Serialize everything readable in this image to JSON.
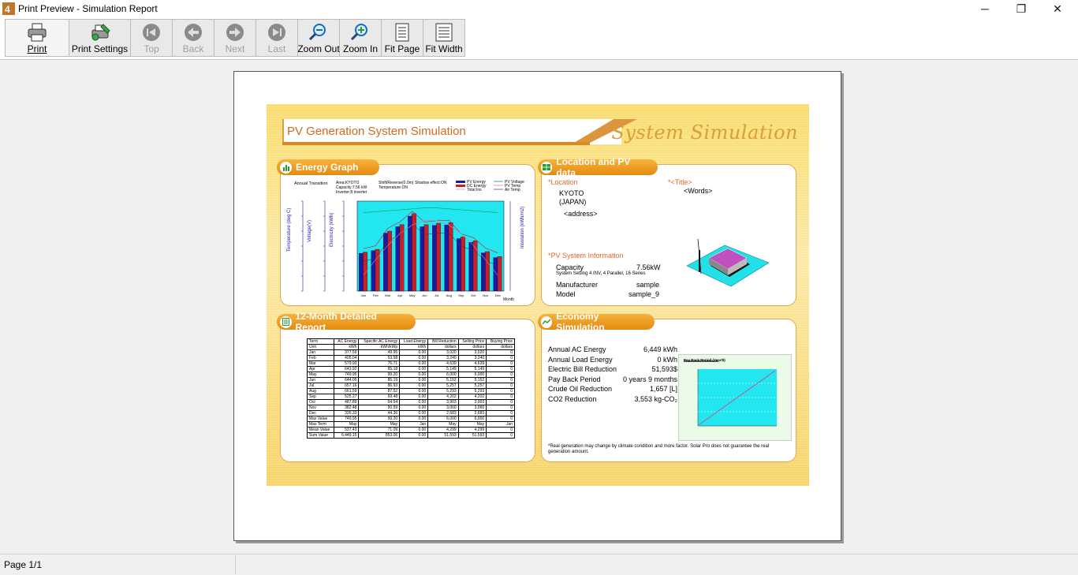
{
  "window": {
    "title": "Print Preview - Simulation Report",
    "controls": [
      "─",
      "❐",
      "✕"
    ]
  },
  "toolbar": {
    "buttons": [
      {
        "label": "Print",
        "icon": "printer-icon",
        "enabled": true
      },
      {
        "label": "Print Settings",
        "icon": "print-settings-icon",
        "enabled": true
      },
      {
        "label": "Top",
        "icon": "first-page-icon",
        "enabled": false
      },
      {
        "label": "Back",
        "icon": "previous-page-icon",
        "enabled": false
      },
      {
        "label": "Next",
        "icon": "next-page-icon",
        "enabled": false
      },
      {
        "label": "Last",
        "icon": "last-page-icon",
        "enabled": false
      },
      {
        "label": "Zoom Out",
        "icon": "zoom-out-icon",
        "enabled": true
      },
      {
        "label": "Zoom In",
        "icon": "zoom-in-icon",
        "enabled": true
      },
      {
        "label": "Fit Page",
        "icon": "fit-page-icon",
        "enabled": true
      },
      {
        "label": "Fit Width",
        "icon": "fit-width-icon",
        "enabled": true
      }
    ]
  },
  "report": {
    "banner_title": "PV Generation System Simulation",
    "banner_script": "System Simulation",
    "energy_graph": {
      "heading": "Energy Graph",
      "annual_transition": "Annual Transition",
      "info_1": "Area:KYOTO",
      "info_2": "Capacity:7.56 kW",
      "info_3": "Inverter:8 Inverter",
      "info_4": "Shift/Reverse(0.0m)",
      "info_5": "Temperature:ON",
      "info_6": "Shadow effect:ON",
      "legend": [
        "PV Energy",
        "DC Energy",
        "Total Ins",
        "PV Voltage",
        "PV Temp",
        "Air Temp"
      ],
      "y_left_1": "Temperature (deg C)",
      "y_left_2": "Voltage(V)",
      "y_left_3": "Electricity (kWh)",
      "y_right": "Insolation (kWh/m2)",
      "x_unit": "Month"
    },
    "location": {
      "heading": "Location and PV data",
      "location_label": "*Location",
      "city": "KYOTO",
      "country": "(JAPAN)",
      "address": "<address>",
      "title_label": "*<Title>",
      "words": "<Words>",
      "pv_info_label": "*PV System Information",
      "capacity_label": "Capacity",
      "capacity_value": "7.56kW",
      "system_setting": "System Setting  4 INV, 4 Parallel, 16 Series",
      "manufacturer_label": "Manufacturer",
      "manufacturer_value": "sample",
      "model_label": "Model",
      "model_value": "sample_9"
    },
    "detail": {
      "heading": "12-Month Detailed Report",
      "header": [
        "Term",
        "AC Energy",
        "Specific AC Energy",
        "Load Energy",
        "Bill Reduction",
        "Selling Price",
        "Buying Price"
      ],
      "units": [
        "Unit",
        "kWh",
        "kWh/kWp",
        "kWh",
        "dollars",
        "dollars",
        "dollars"
      ],
      "rows": [
        [
          "Jan",
          "377.59",
          "49.95",
          "0.00",
          "3,020",
          "3,020",
          "0"
        ],
        [
          "Feb",
          "405.04",
          "53.58",
          "0.00",
          "3,240",
          "3,240",
          "0"
        ],
        [
          "Mar",
          "579.93",
          "76.71",
          "0.00",
          "4,639",
          "4,639",
          "0"
        ],
        [
          "Apr",
          "643.92",
          "85.18",
          "0.00",
          "5,149",
          "5,149",
          "0"
        ],
        [
          "May",
          "749.95",
          "99.20",
          "0.00",
          "6,000",
          "6,000",
          "0"
        ],
        [
          "Jun",
          "644.05",
          "85.19",
          "0.00",
          "5,152",
          "5,152",
          "0"
        ],
        [
          "Jul",
          "657.16",
          "86.93",
          "0.00",
          "5,257",
          "5,257",
          "0"
        ],
        [
          "Aug",
          "661.59",
          "87.52",
          "0.00",
          "5,293",
          "5,293",
          "0"
        ],
        [
          "Sep",
          "525.27",
          "69.48",
          "0.00",
          "4,202",
          "4,202",
          "0"
        ],
        [
          "Oct",
          "487.89",
          "64.54",
          "0.00",
          "3,903",
          "3,903",
          "0"
        ],
        [
          "Nov",
          "382.48",
          "50.59",
          "0.00",
          "3,060",
          "3,060",
          "0"
        ],
        [
          "Dec",
          "335.33",
          "44.36",
          "0.00",
          "2,683",
          "2,683",
          "0"
        ]
      ],
      "max_value": [
        "Max Value",
        "749.95",
        "99.20",
        "0.00",
        "6,000",
        "6,000",
        "0"
      ],
      "max_term": [
        "Max Term",
        "May",
        "May",
        "Jan",
        "May",
        "May",
        "Jan"
      ],
      "mean_value": [
        "Mean Value",
        "537.43",
        "71.09",
        "0.00",
        "4,299",
        "4,299",
        "0"
      ],
      "sum_value": [
        "Sum Value",
        "6,449.15",
        "853.06",
        "0.00",
        "51,593",
        "51,593",
        "0"
      ]
    },
    "economy": {
      "heading": "Economy Simulation",
      "items": [
        {
          "label": "Annual AC Energy",
          "value": "6,449 kWh"
        },
        {
          "label": "Annual Load Energy",
          "value": "0 kWh"
        },
        {
          "label": "Electric Bill Reduction",
          "value": "51,593$"
        },
        {
          "label": "Pay Back Period",
          "value": "0 years  9 months"
        },
        {
          "label": "Crude Oil Reduction",
          "value": "1,657 [L]"
        },
        {
          "label": "CO2 Reduction",
          "value": "3,553 kg-CO₂"
        }
      ],
      "note": "*Real generation may change by climate condition and more factor. Solar Pro does not guarantee the real generation amount.",
      "chart_title": "Pay Back Period (Year/$)"
    }
  },
  "status": {
    "page": "Page  1/1"
  },
  "chart_data": {
    "type": "bar",
    "categories": [
      "Jan",
      "Feb",
      "Mar",
      "Apr",
      "May",
      "Jun",
      "Jul",
      "Aug",
      "Sep",
      "Oct",
      "Nov",
      "Dec"
    ],
    "series": [
      {
        "name": "PV Energy",
        "values": [
          378,
          405,
          580,
          644,
          750,
          644,
          657,
          662,
          525,
          488,
          382,
          335
        ]
      },
      {
        "name": "DC Energy",
        "values": [
          390,
          418,
          600,
          665,
          775,
          665,
          679,
          684,
          543,
          504,
          395,
          346
        ]
      }
    ],
    "ylim": [
      0,
      900
    ],
    "colors": {
      "pv": "#1a1aa8",
      "dc": "#c8202a",
      "plot_bg": "#22e6f0"
    }
  }
}
